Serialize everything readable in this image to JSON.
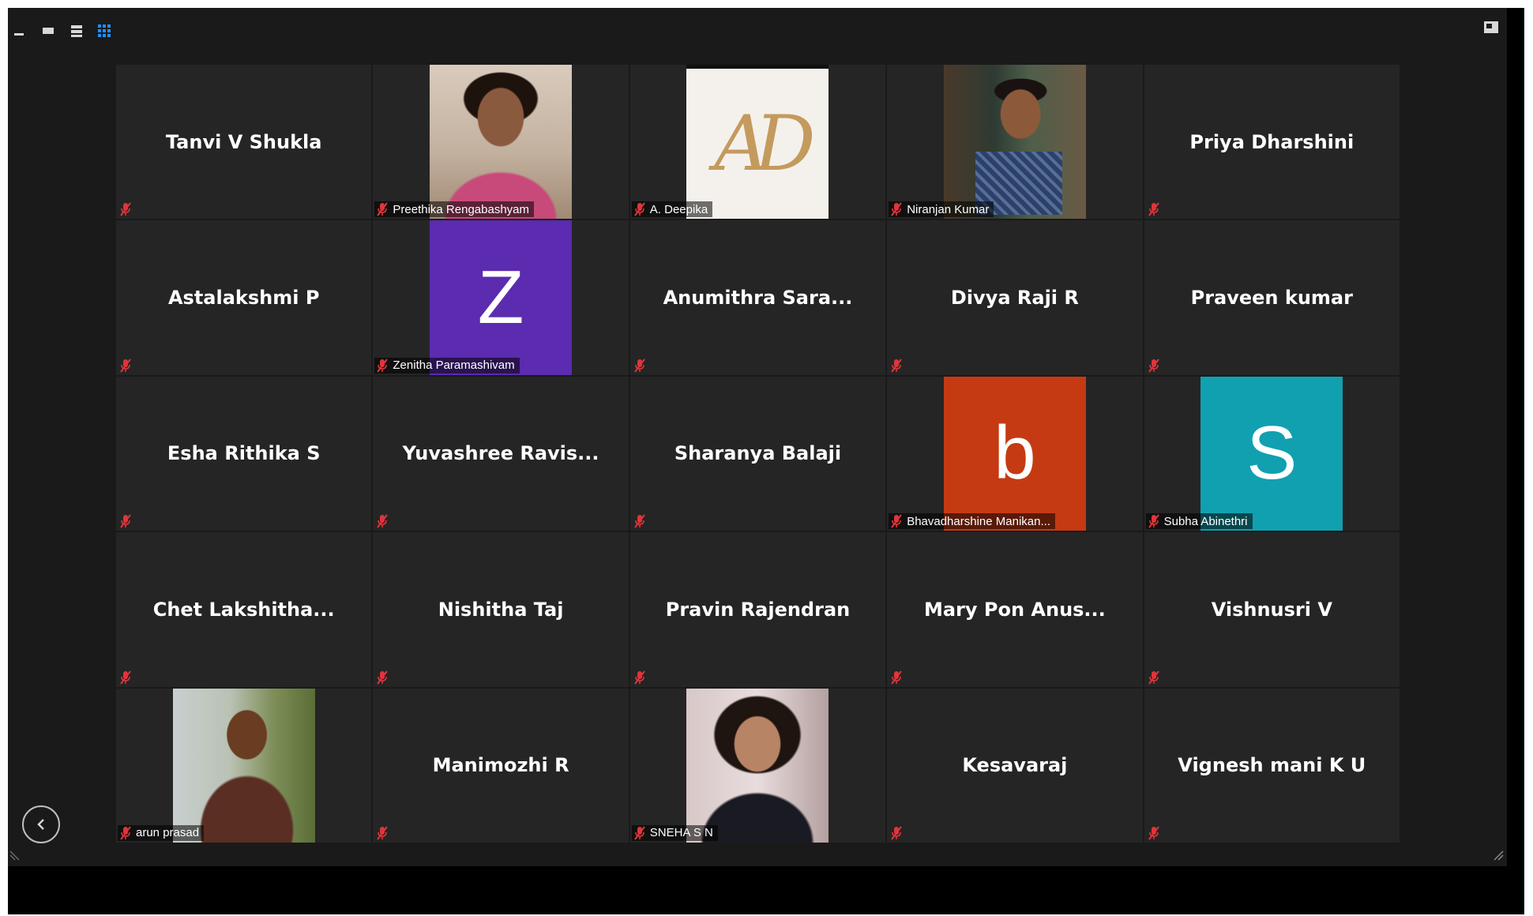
{
  "colors": {
    "window_bg": "#000000",
    "stage_bg": "#1a1a1a",
    "tile_bg": "#252525",
    "mute_icon": "#e0343a",
    "active_view_icon": "#1e90ff"
  },
  "icons": {
    "view_modes": [
      "minimize-icon",
      "speaker-view-icon",
      "gallery-strip-icon",
      "gallery-view-icon"
    ],
    "exit_fullscreen": "exit-fullscreen-icon",
    "back": "chevron-left-icon",
    "mute": "microphone-muted-icon"
  },
  "participants": [
    {
      "display_name": "Tanvi V Shukla"
    },
    {
      "label": "Preethika Rengabashyam",
      "video": "photo",
      "media_class": "media-photo-woman-pink"
    },
    {
      "label": "A. Deepika",
      "video": "logo",
      "logo_text": "AD"
    },
    {
      "label": "Niranjan Kumar",
      "video": "photo",
      "media_class": "media-photo-man-cafe"
    },
    {
      "display_name": "Priya Dharshini"
    },
    {
      "display_name": "Astalakshmi P"
    },
    {
      "label": "Zenitha Paramashivam",
      "avatar_letter": "Z",
      "avatar_color": "#5b2bb0"
    },
    {
      "display_name": "Anumithra  Sara..."
    },
    {
      "display_name": "Divya Raji R"
    },
    {
      "display_name": "Praveen kumar"
    },
    {
      "display_name": "Esha Rithika S"
    },
    {
      "display_name": "Yuvashree  Ravis..."
    },
    {
      "display_name": "Sharanya Balaji"
    },
    {
      "label": "Bhavadharshine Manikan...",
      "avatar_letter": "b",
      "avatar_color": "#c53a12"
    },
    {
      "label": "Subha Abinethri",
      "avatar_letter": "S",
      "avatar_color": "#11a0b0"
    },
    {
      "display_name": "Chet  Lakshitha..."
    },
    {
      "display_name": "Nishitha Taj"
    },
    {
      "display_name": "Pravin Rajendran"
    },
    {
      "display_name": "Mary  Pon  Anus..."
    },
    {
      "display_name": "Vishnusri V"
    },
    {
      "label": "arun prasad",
      "video": "photo",
      "media_class": "media-photo-man-outdoor"
    },
    {
      "display_name": "Manimozhi R"
    },
    {
      "label": "SNEHA S N",
      "video": "photo",
      "media_class": "media-photo-woman-dark"
    },
    {
      "display_name": "Kesavaraj"
    },
    {
      "display_name": "Vignesh mani K U"
    }
  ]
}
